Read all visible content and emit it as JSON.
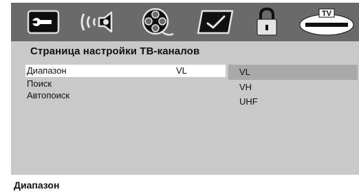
{
  "tabs": [
    {
      "icon": "wrench-icon"
    },
    {
      "icon": "speaker-audio-icon"
    },
    {
      "icon": "film-reel-icon"
    },
    {
      "icon": "checkmark-icon"
    },
    {
      "icon": "padlock-icon"
    },
    {
      "icon": "tv-icon",
      "label": "TV"
    }
  ],
  "page_title": "Страница настройки ТВ-каналов",
  "menu": [
    {
      "label": "Диапазон",
      "value": "VL"
    },
    {
      "label": "Поиск"
    },
    {
      "label": "Автопоиск"
    }
  ],
  "options": [
    "VL",
    "VH",
    "UHF"
  ],
  "help_text": "Диапазон",
  "colors": {
    "iconbar": "#6a6a6a",
    "panel": "#c9c9c9",
    "selected_row": "#ffffff",
    "selected_option": "#a9a9a9"
  }
}
